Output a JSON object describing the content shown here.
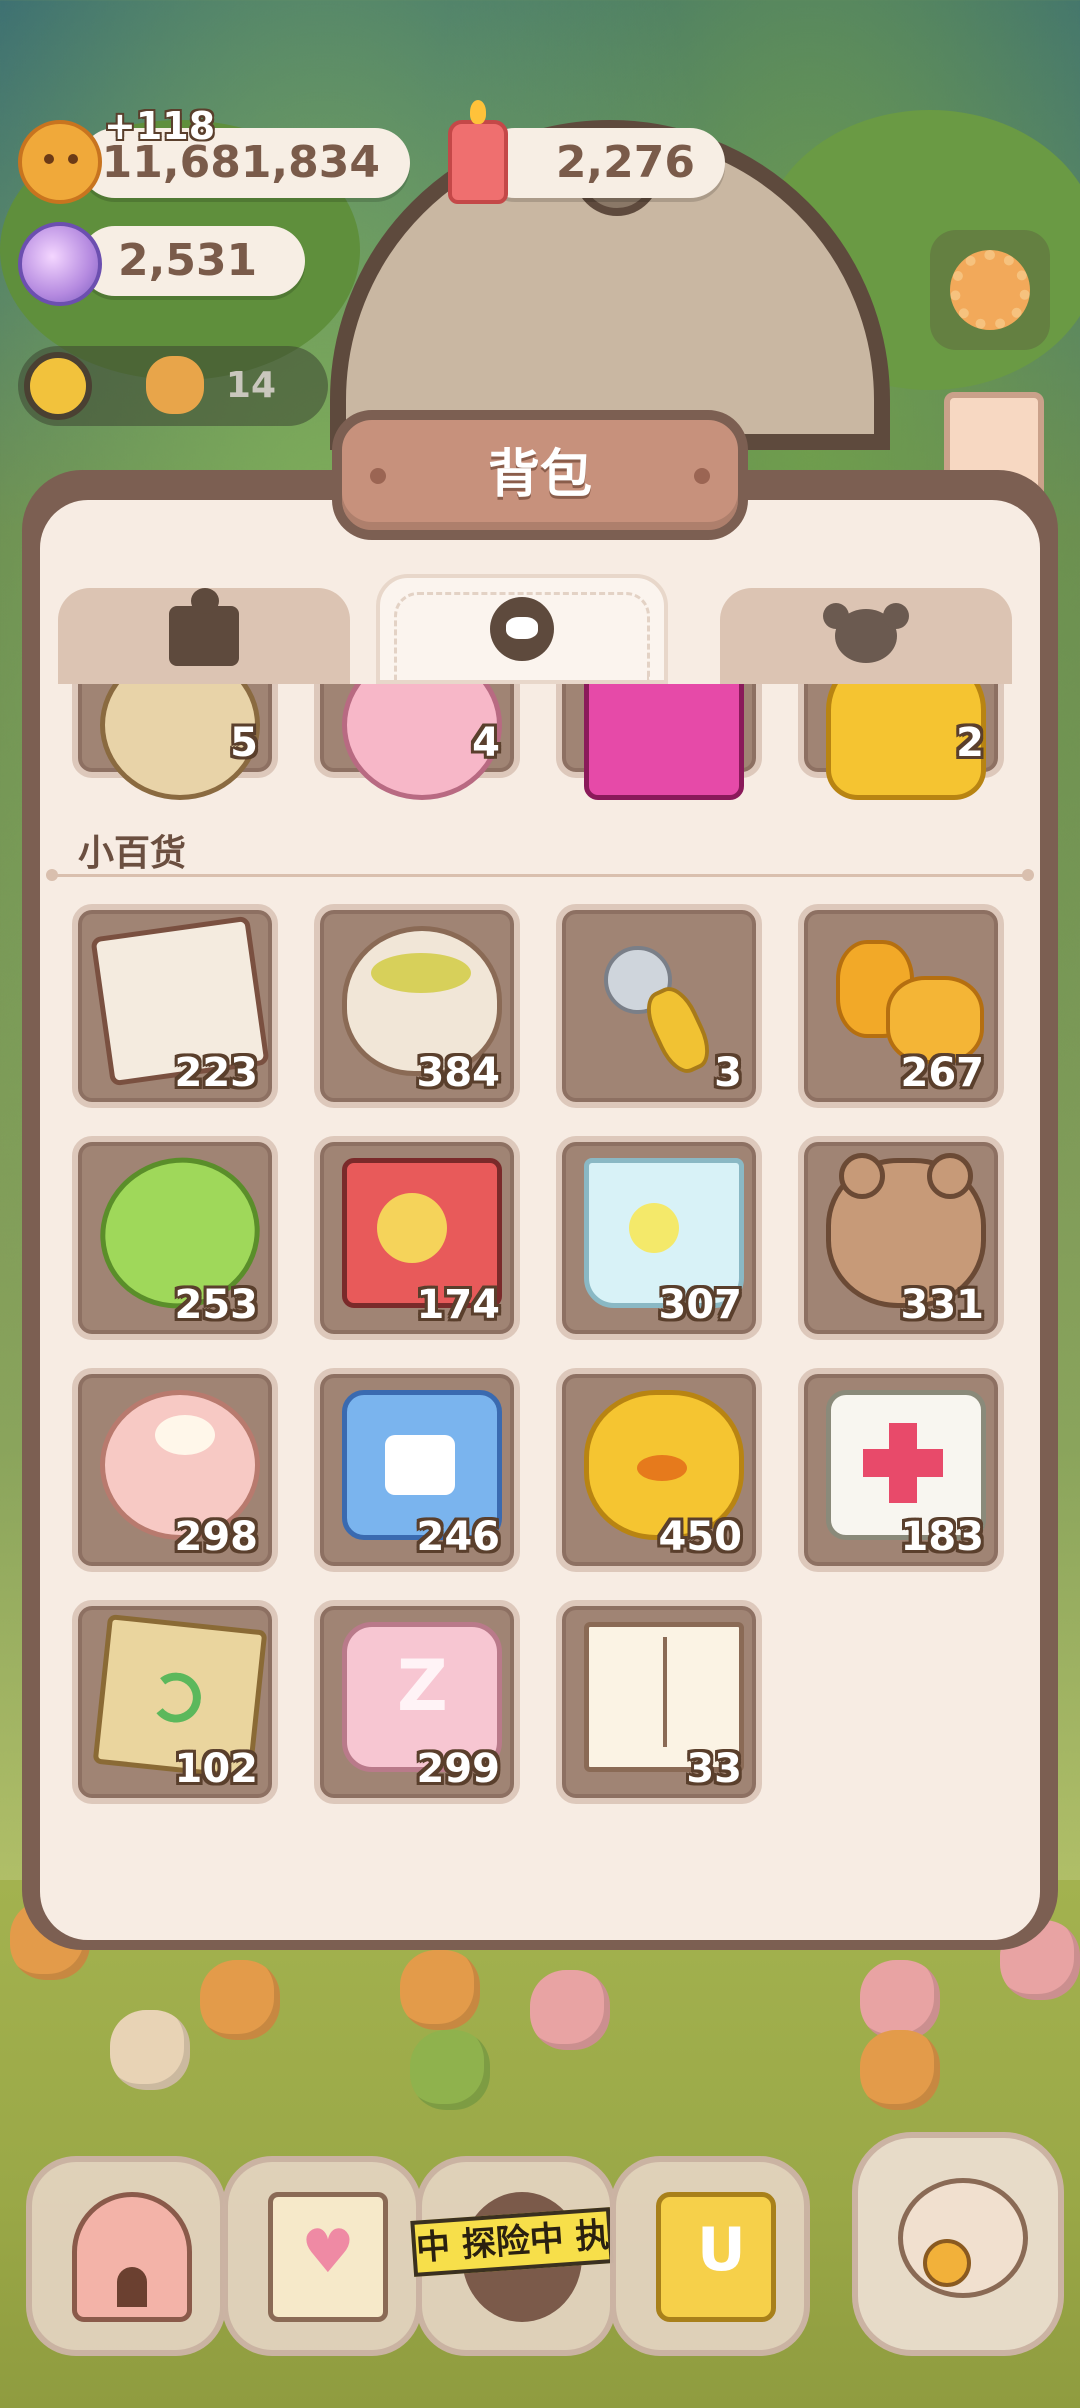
{
  "currencies": {
    "cookies": "11,681,834",
    "cookies_gain": "+118",
    "candles": "2,276",
    "crystals": "2,531",
    "energy": "14"
  },
  "bag": {
    "title": "背包",
    "tabs": [
      {
        "icon": "box-icon",
        "active": false
      },
      {
        "icon": "cookie-face-icon",
        "active": true
      },
      {
        "icon": "koala-icon",
        "active": false
      }
    ],
    "top_row": [
      {
        "name": "potato",
        "count": "5"
      },
      {
        "name": "donut-toys",
        "count": "4"
      },
      {
        "name": "chips-bag",
        "count": ""
      },
      {
        "name": "golden-trophy",
        "count": "2"
      }
    ],
    "section_title": "小百货",
    "items": [
      {
        "name": "newspaper",
        "count": "223"
      },
      {
        "name": "tea-cup",
        "count": "384"
      },
      {
        "name": "spoon-fork",
        "count": "3"
      },
      {
        "name": "slippers",
        "count": "267"
      },
      {
        "name": "soap",
        "count": "253"
      },
      {
        "name": "comic-book",
        "count": "174"
      },
      {
        "name": "lemon-water",
        "count": "307"
      },
      {
        "name": "teddy-bear",
        "count": "331"
      },
      {
        "name": "cake",
        "count": "298"
      },
      {
        "name": "detergent",
        "count": "246"
      },
      {
        "name": "duck-toy",
        "count": "450"
      },
      {
        "name": "first-aid-kit",
        "count": "183"
      },
      {
        "name": "paper-bag",
        "count": "102"
      },
      {
        "name": "pillow",
        "count": "299"
      },
      {
        "name": "magazine",
        "count": "33"
      }
    ]
  },
  "bottom_nav": {
    "explore_label": "中 探险中 执"
  }
}
